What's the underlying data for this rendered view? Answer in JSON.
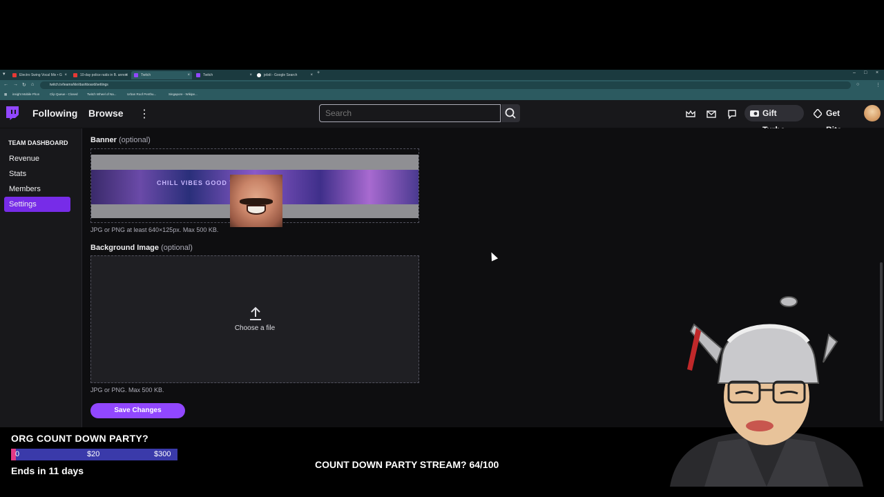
{
  "browser": {
    "tabs": [
      {
        "label": "Electro Swing Vocal Mix • G",
        "fav": "#e53935"
      },
      {
        "label": "10-day police raids in B. annou",
        "fav": "#e53935"
      },
      {
        "label": "Twitch",
        "fav": "#9147ff"
      },
      {
        "label": "Twitch",
        "fav": "#9147ff"
      },
      {
        "label": "jebdi - Google Search",
        "fav": "#ffffff"
      }
    ],
    "url": "twitch.tv/teams/kkr/dashboard/settings",
    "bookmarks": [
      "insight Mobile Phon",
      "Clip Queue - Closed",
      "Twitch Wheel of Na...",
      "Urban Roof Penthu...",
      "Singapore - Wikipe..."
    ]
  },
  "topnav": {
    "following": "Following",
    "browse": "Browse",
    "more": "⋮",
    "search_placeholder": "Search",
    "gift_turbo": "Gift Turbo",
    "get_bits": "Get Bits"
  },
  "sidebar": {
    "heading": "TEAM DASHBOARD",
    "items": [
      {
        "label": "Revenue"
      },
      {
        "label": "Stats"
      },
      {
        "label": "Members"
      },
      {
        "label": "Settings"
      }
    ]
  },
  "main": {
    "banner_label": "Banner",
    "banner_optional": "(optional)",
    "banner_image_text": "CHILL VIBES GOOD TIMES",
    "banner_hint": "JPG or PNG at least 640×125px. Max 500 KB.",
    "background_label": "Background Image",
    "background_optional": "(optional)",
    "choose_file": "Choose a file",
    "background_hint": "JPG or PNG. Max 500 KB.",
    "save_button": "Save Changes"
  },
  "overlay": {
    "goal_title": "ORG COUNT DOWN PARTY?",
    "goal_current": "0",
    "goal_mid": "$20",
    "goal_target": "$300",
    "goal_progress": 0.03,
    "goal_ends": "Ends in 11 days",
    "stream_line": "COUNT DOWN PARTY STREAM? 64/100"
  },
  "colors": {
    "accent": "#9147ff",
    "active_nav": "#772ce8",
    "goal_fill": "#e23a86",
    "goal_bar": "#3a3aaa"
  }
}
